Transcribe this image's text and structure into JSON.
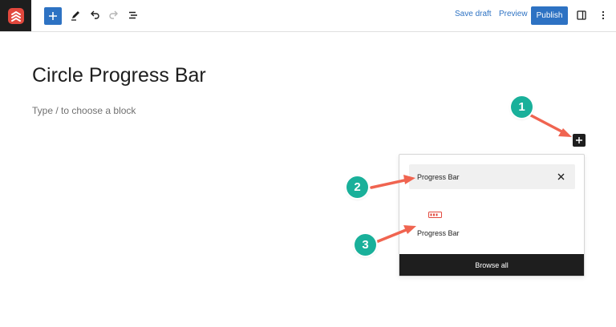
{
  "toolbar": {
    "logo_icon": "site-logo-icon",
    "add_block_icon": "plus-icon",
    "tools_icon": "pencil-icon",
    "undo_icon": "undo-icon",
    "redo_icon": "redo-icon",
    "outline_icon": "list-view-icon",
    "save_draft_label": "Save draft",
    "preview_label": "Preview",
    "publish_label": "Publish",
    "settings_icon": "sidebar-toggle-icon",
    "options_icon": "more-vertical-icon"
  },
  "editor": {
    "post_title": "Circle Progress Bar",
    "block_placeholder": "Type / to choose a block",
    "inline_inserter_icon": "plus-icon"
  },
  "inserter": {
    "search_value": "Progress Bar",
    "clear_icon": "close-icon",
    "results": [
      {
        "label": "Progress Bar",
        "icon": "progress-bar-icon"
      }
    ],
    "browse_all_label": "Browse all"
  },
  "annotations": {
    "steps": [
      "1",
      "2",
      "3"
    ],
    "badge_color": "#19b09a",
    "arrow_color": "#f06450"
  },
  "colors": {
    "accent": "#2d72c3",
    "dark": "#1e1e1e",
    "logo_red": "#e2483d"
  }
}
